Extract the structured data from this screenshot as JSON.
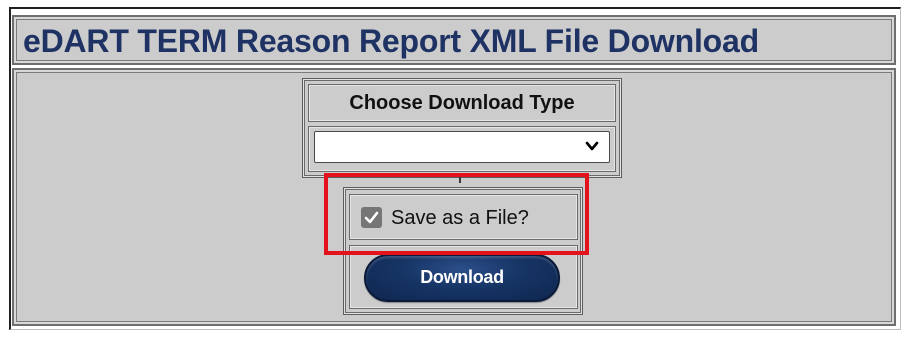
{
  "page": {
    "title": "eDART TERM Reason Report XML File Download"
  },
  "type_select": {
    "label": "Choose Download Type",
    "value": "",
    "chevron_icon": "chevron-down-icon"
  },
  "save_option": {
    "label": "Save as a File?",
    "checked": true,
    "check_icon": "checkmark-icon"
  },
  "actions": {
    "download_label": "Download"
  },
  "colors": {
    "title_text": "#1f3264",
    "panel_bg": "#cccccc",
    "button_bg": "#163464",
    "highlight": "#e3121b"
  }
}
